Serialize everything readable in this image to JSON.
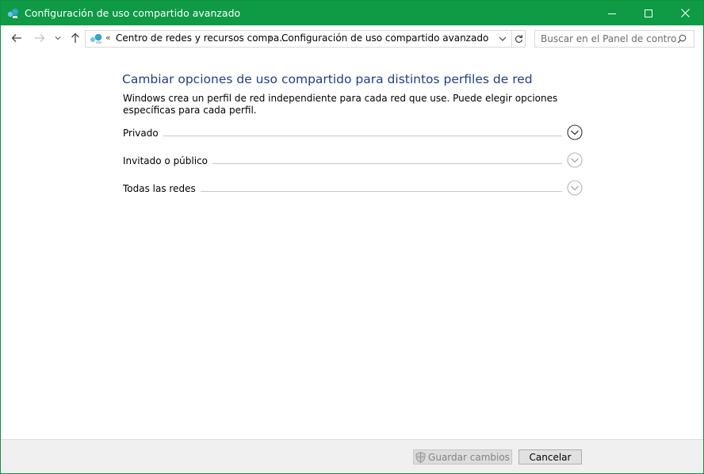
{
  "window": {
    "title": "Configuración de uso compartido avanzado",
    "accent_color": "#0f9a45",
    "app_icon": "network-sharing-icon"
  },
  "nav": {
    "breadcrumb_overflow": "«",
    "breadcrumb": [
      "Centro de redes y recursos compa...",
      "Configuración de uso compartido avanzado"
    ],
    "separator": "›",
    "search_placeholder": "Buscar en el Panel de control"
  },
  "main": {
    "heading": "Cambiar opciones de uso compartido para distintos perfiles de red",
    "description": "Windows crea un perfil de red independiente para cada red que use. Puede elegir opciones específicas para cada perfil.",
    "heading_color": "#1e3f86",
    "sections": [
      {
        "label": "Privado",
        "expanded": false,
        "active": true
      },
      {
        "label": "Invitado o público",
        "expanded": false,
        "active": false
      },
      {
        "label": "Todas las redes",
        "expanded": false,
        "active": false
      }
    ]
  },
  "footer": {
    "save_label": "Guardar cambios",
    "save_enabled": false,
    "cancel_label": "Cancelar"
  }
}
